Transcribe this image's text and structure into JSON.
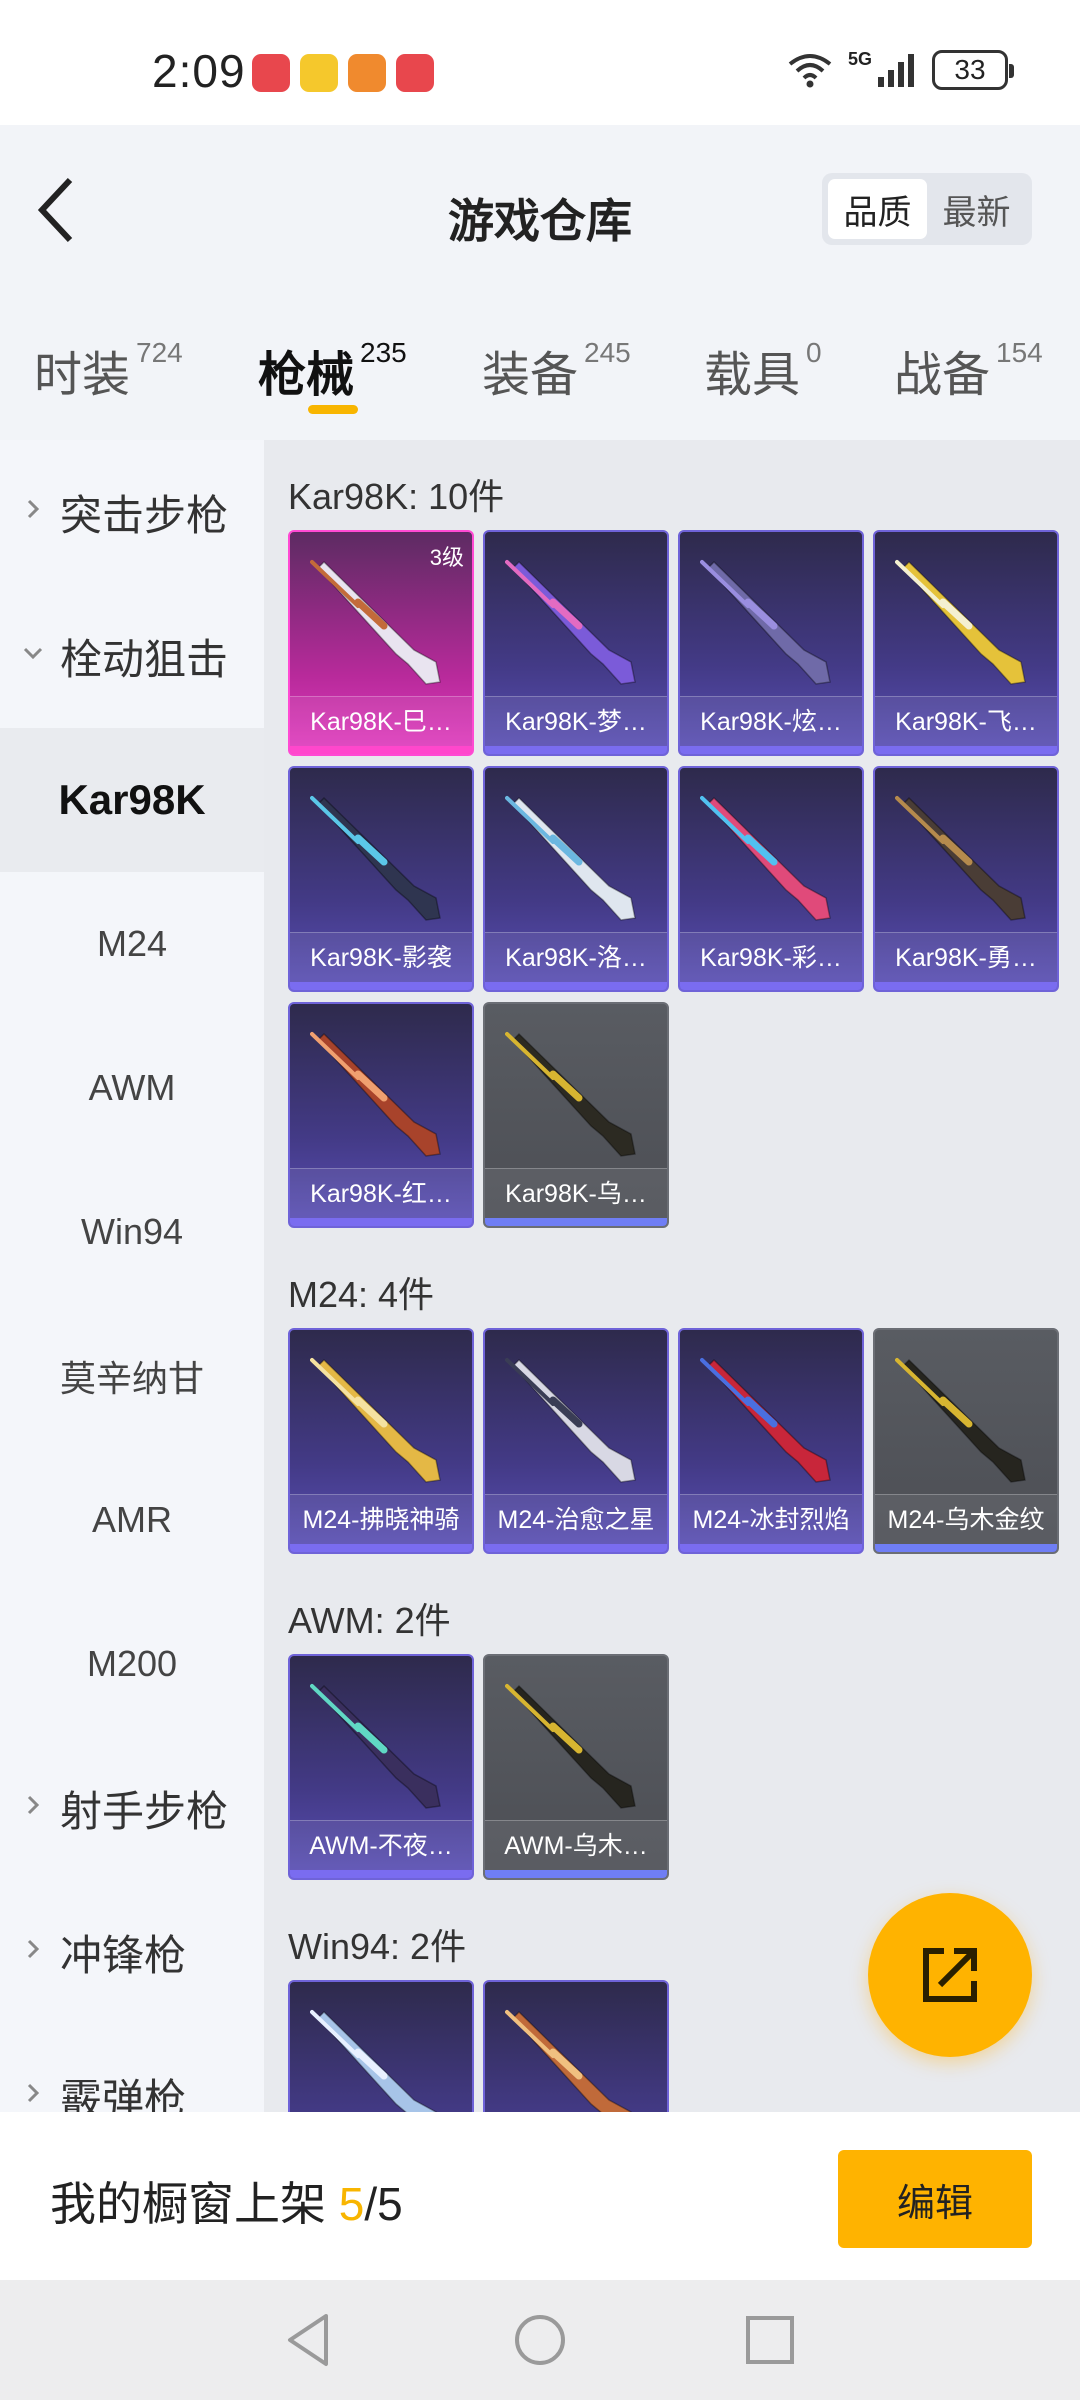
{
  "status_bar": {
    "time": "2:09",
    "network": "5G",
    "battery": "33"
  },
  "header": {
    "title": "游戏仓库",
    "sort_options": [
      "品质",
      "最新"
    ],
    "active_sort": "品质"
  },
  "tabs": [
    {
      "label": "时装",
      "count": "724"
    },
    {
      "label": "枪械",
      "count": "235",
      "active": true
    },
    {
      "label": "装备",
      "count": "245"
    },
    {
      "label": "载具",
      "count": "0"
    },
    {
      "label": "战备",
      "count": "154"
    }
  ],
  "sidenav": [
    {
      "label": "突击步枪",
      "type": "group-collapsed"
    },
    {
      "label": "栓动狙击",
      "type": "group-expanded"
    },
    {
      "label": "Kar98K",
      "type": "item",
      "active": true
    },
    {
      "label": "M24",
      "type": "item"
    },
    {
      "label": "AWM",
      "type": "item"
    },
    {
      "label": "Win94",
      "type": "item"
    },
    {
      "label": "莫辛纳甘",
      "type": "item"
    },
    {
      "label": "AMR",
      "type": "item"
    },
    {
      "label": "M200",
      "type": "item"
    },
    {
      "label": "射手步枪",
      "type": "group-collapsed"
    },
    {
      "label": "冲锋枪",
      "type": "group-collapsed"
    },
    {
      "label": "霰弹枪",
      "type": "group-collapsed"
    }
  ],
  "groups": [
    {
      "title": "Kar98K: 10件",
      "items": [
        {
          "name": "Kar98K-巳…",
          "tier": "pink",
          "level": "3级",
          "gun_color": "#e9e4f0",
          "accent": "#c36b3a"
        },
        {
          "name": "Kar98K-梦…",
          "tier": "purple",
          "gun_color": "#7b5bd9",
          "accent": "#e36bc2"
        },
        {
          "name": "Kar98K-炫…",
          "tier": "purple",
          "gun_color": "#6f6aa8",
          "accent": "#9a8ee0"
        },
        {
          "name": "Kar98K-飞…",
          "tier": "purple",
          "gun_color": "#e5c23a",
          "accent": "#f4f0d0"
        },
        {
          "name": "Kar98K-影袭",
          "tier": "purple",
          "gun_color": "#2f3550",
          "accent": "#5bc7e8"
        },
        {
          "name": "Kar98K-洛…",
          "tier": "purple",
          "gun_color": "#dfe6ef",
          "accent": "#6bb7e0"
        },
        {
          "name": "Kar98K-彩…",
          "tier": "purple",
          "gun_color": "#e04a7a",
          "accent": "#51c1f0"
        },
        {
          "name": "Kar98K-勇…",
          "tier": "purple",
          "gun_color": "#4a3d36",
          "accent": "#b58a4d"
        },
        {
          "name": "Kar98K-红…",
          "tier": "purple",
          "gun_color": "#a8432b",
          "accent": "#f0a070"
        },
        {
          "name": "Kar98K-乌…",
          "tier": "grey",
          "gun_color": "#2c2a22",
          "accent": "#d7b531"
        }
      ]
    },
    {
      "title": "M24: 4件",
      "items": [
        {
          "name": "M24-拂晓神骑",
          "tier": "purple",
          "gun_color": "#e4b845",
          "accent": "#f5e2a0"
        },
        {
          "name": "M24-治愈之星",
          "tier": "purple",
          "gun_color": "#d8d8e4",
          "accent": "#3a3d55"
        },
        {
          "name": "M24-冰封烈焰",
          "tier": "purple",
          "gun_color": "#c8263a",
          "accent": "#4a6fe0"
        },
        {
          "name": "M24-乌木金纹",
          "tier": "grey",
          "gun_color": "#26251f",
          "accent": "#d7b531"
        }
      ]
    },
    {
      "title": "AWM: 2件",
      "items": [
        {
          "name": "AWM-不夜…",
          "tier": "purple",
          "gun_color": "#3a2f5e",
          "accent": "#60d8c4"
        },
        {
          "name": "AWM-乌木…",
          "tier": "grey",
          "gun_color": "#26251f",
          "accent": "#d7b531"
        }
      ]
    },
    {
      "title": "Win94: 2件",
      "items": [
        {
          "name": "",
          "tier": "purple",
          "gun_color": "#a7c4e8",
          "accent": "#e8f0ff"
        },
        {
          "name": "",
          "tier": "purple",
          "gun_color": "#c06a3a",
          "accent": "#f0c080"
        }
      ]
    }
  ],
  "bottom_bar": {
    "prefix": "我的橱窗上架 ",
    "current": "5",
    "total": "/5",
    "edit_label": "编辑"
  },
  "icons": {
    "back": "back-arrow-icon",
    "fab": "share-edit-icon",
    "expand": "chevron-right-icon",
    "collapse": "chevron-down-icon"
  },
  "colors": {
    "accent": "#ffb300",
    "tab_underline": "#f8b500"
  }
}
